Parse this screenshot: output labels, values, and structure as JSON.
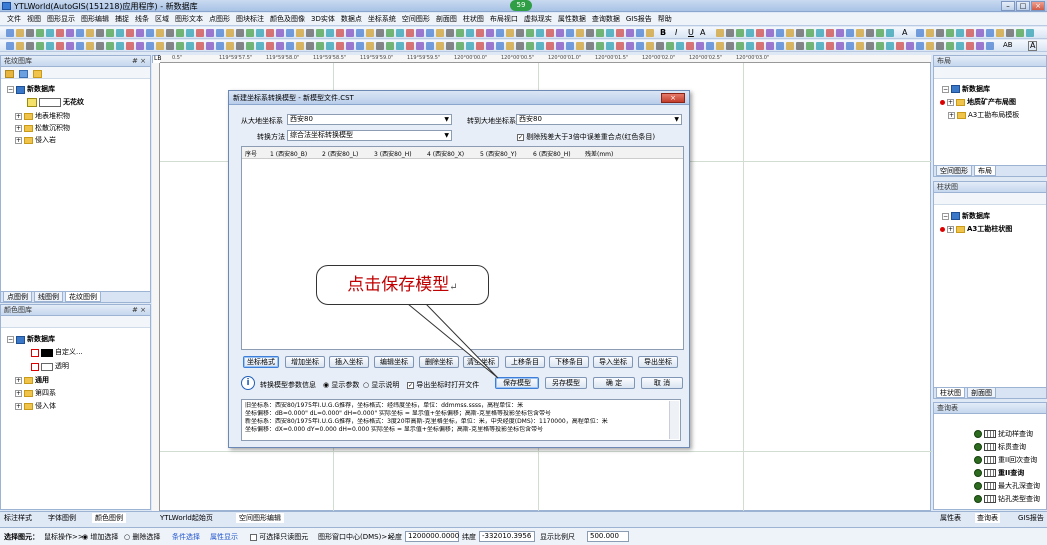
{
  "window": {
    "title": "YTLWorld(AutoGIS(151218)应用程序) - 新数据库",
    "badge": "59",
    "controls": [
      "–",
      "□",
      "×"
    ]
  },
  "menu": [
    "文件",
    "视图",
    "图形显示",
    "图形编辑",
    "捕捉",
    "线条",
    "区域",
    "图形文本",
    "点图形",
    "图块标注",
    "颜色及图像",
    "3D实体",
    "数据点",
    "坐标系统",
    "空间图形",
    "剖面图",
    "柱状图",
    "布局视口",
    "虚拟现实",
    "属性数据",
    "查询数据",
    "GIS报告",
    "帮助"
  ],
  "toolbar": {
    "bold": "B",
    "italic": "I",
    "underline": "U",
    "font_a": "A",
    "text_a": "A",
    "ab": "AB",
    "a_box": "A"
  },
  "left_top_panel": {
    "title": "花纹图库",
    "pin": "# ×",
    "tree": [
      {
        "label": "新数据库",
        "kind": "db"
      },
      {
        "label": "无花纹",
        "kind": "swatch"
      },
      {
        "label": "地表堆积物",
        "kind": "folder"
      },
      {
        "label": "松散沉积物",
        "kind": "folder"
      },
      {
        "label": "侵入岩",
        "kind": "folder"
      }
    ],
    "tabs": [
      "点图例",
      "线图例",
      "花纹图例"
    ]
  },
  "left_mid_panel": {
    "title": "颜色图库",
    "pin": "# ×",
    "tree": [
      {
        "label": "新数据库"
      },
      {
        "label": "自定义..."
      },
      {
        "label": "透明"
      },
      {
        "label": "通用"
      },
      {
        "label": "第四系"
      },
      {
        "label": "侵入体"
      }
    ]
  },
  "bottom_tabs": [
    "标注样式",
    "字体图例",
    "颜色图例",
    "YTLWorld起始页",
    "空间图形编辑"
  ],
  "canvas": {
    "corner_label": "LB",
    "ruler_top": [
      "0.5\"",
      "119°59'57.5\"",
      "119°59'58.0\"",
      "119°59'58.5\"",
      "119°59'59.0\"",
      "119°59'59.5\"",
      "120°00'00.0\"",
      "120°00'00.5\"",
      "120°00'01.0\"",
      "120°00'01.5\"",
      "120°00'02.0\"",
      "120°00'02.5\"",
      "120°00'03.0\""
    ]
  },
  "right_top_panel": {
    "title": "布局",
    "rows": [
      {
        "label": "新数据库"
      },
      {
        "label": "地质矿产布局图"
      },
      {
        "label": "A3工勘布局模板"
      }
    ],
    "tabs": [
      "空间图形",
      "布局"
    ]
  },
  "right_mid_panel": {
    "title": "柱状图",
    "rows": [
      {
        "label": "新数据库"
      },
      {
        "label": "A3工勘柱状图"
      }
    ],
    "tabs": [
      "柱状图",
      "剖面图"
    ]
  },
  "right_bottom_panel": {
    "title": "查询表",
    "rows": [
      "扰动样查询",
      "标贯查询",
      "重II回次查询",
      "重II查询",
      "最大孔深查询",
      "钻孔类型查询"
    ],
    "tabs": [
      "属性表",
      "查询表",
      "GIS报告"
    ]
  },
  "dialog": {
    "title": "新建坐标系转换模型 - 新模型文件.CST",
    "close": "×",
    "from_label": "从大地坐标系",
    "from_value": "西安80",
    "to_label": "转到大地坐标系",
    "to_value": "西安80",
    "method_label": "转换方法",
    "method_value": "综合法坐标转换模型",
    "remove_outliers_label": "剔除残差大于3倍中误差重合点(红色条目)",
    "columns": [
      "序号",
      "1 (西安80_B)",
      "2 (西安80_L)",
      "3 (西安80_H)",
      "4 (西安80_X)",
      "5 (西安80_Y)",
      "6 (西安80_H)",
      "残差(mm)"
    ],
    "buttons_row1": [
      "坐标格式",
      "增加坐标",
      "插入坐标",
      "编辑坐标",
      "删除坐标",
      "清空坐标",
      "上移条目",
      "下移条目",
      "导入坐标",
      "导出坐标"
    ],
    "info_label": "转换模型参数信息",
    "radio_params": "显示参数",
    "radio_explain": "显示说明",
    "open_after_export": "导出坐标时打开文件",
    "save_model": "保存模型",
    "save_as": "另存模型",
    "ok": "确 定",
    "cancel": "取 消",
    "info_lines": [
      "旧坐标系：西安80/1975年I.U.G.G推荐，坐标格式：经纬度坐标，单位：ddmmss.ssss，高程单位：米",
      "坐标偏移：dB=0.000\"  dL=0.000\"  dH=0.000\"  实际坐标 = 显示值+坐标偏移；高斯-克里格等投影坐标包含带号",
      "",
      "新坐标系：西安80/1975年I.U.G.G推荐，坐标格式：3度20带高斯-克里格坐标，单位：米，中央经度(DMS)：1170000，高程单位：米",
      "坐标偏移：dX=0.000   dY=0.000   dH=0.000   实际坐标 = 显示值+坐标偏移；高斯-克里格等投影坐标包含带号"
    ]
  },
  "callout": {
    "text": "点击保存模型"
  },
  "statusbar": {
    "select_label": "选择图元：",
    "mode_label": "鼠标操作>>",
    "add_select": "增加选择",
    "remove_select": "删除选择",
    "cond_select": "条件选择",
    "attr_show": "属性显示",
    "only_selectable": "可选择只读图元",
    "view_center_label": "图形窗口中心(DMS)>>",
    "lon_label": "经度",
    "lon_value": "1200000.0000",
    "lat_label": "纬度",
    "lat_value": "-332010.3956",
    "scale_label": "显示比例尺",
    "scale_value": "500.000"
  }
}
